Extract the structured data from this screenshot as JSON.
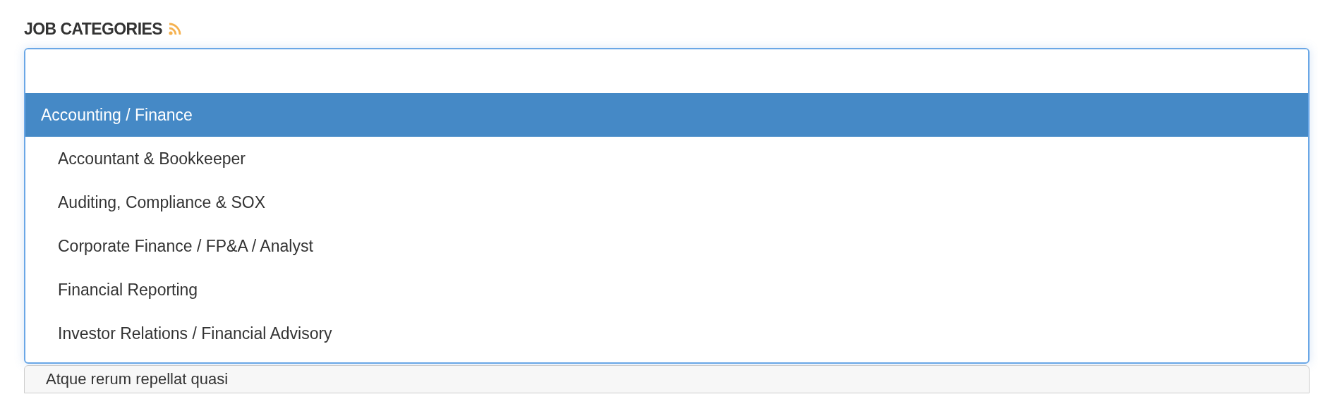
{
  "heading": {
    "title": "JOB CATEGORIES"
  },
  "dropdown": {
    "options": [
      {
        "label": "Accounting / Finance",
        "kind": "group",
        "selected": true
      },
      {
        "label": "Accountant & Bookkeeper",
        "kind": "option",
        "selected": false
      },
      {
        "label": "Auditing, Compliance & SOX",
        "kind": "option",
        "selected": false
      },
      {
        "label": "Corporate Finance / FP&A / Analyst",
        "kind": "option",
        "selected": false
      },
      {
        "label": "Financial Reporting",
        "kind": "option",
        "selected": false
      },
      {
        "label": "Investor Relations / Financial Advisory",
        "kind": "option",
        "selected": false
      }
    ]
  },
  "next_field": {
    "value": "Atque rerum repellat quasi"
  }
}
